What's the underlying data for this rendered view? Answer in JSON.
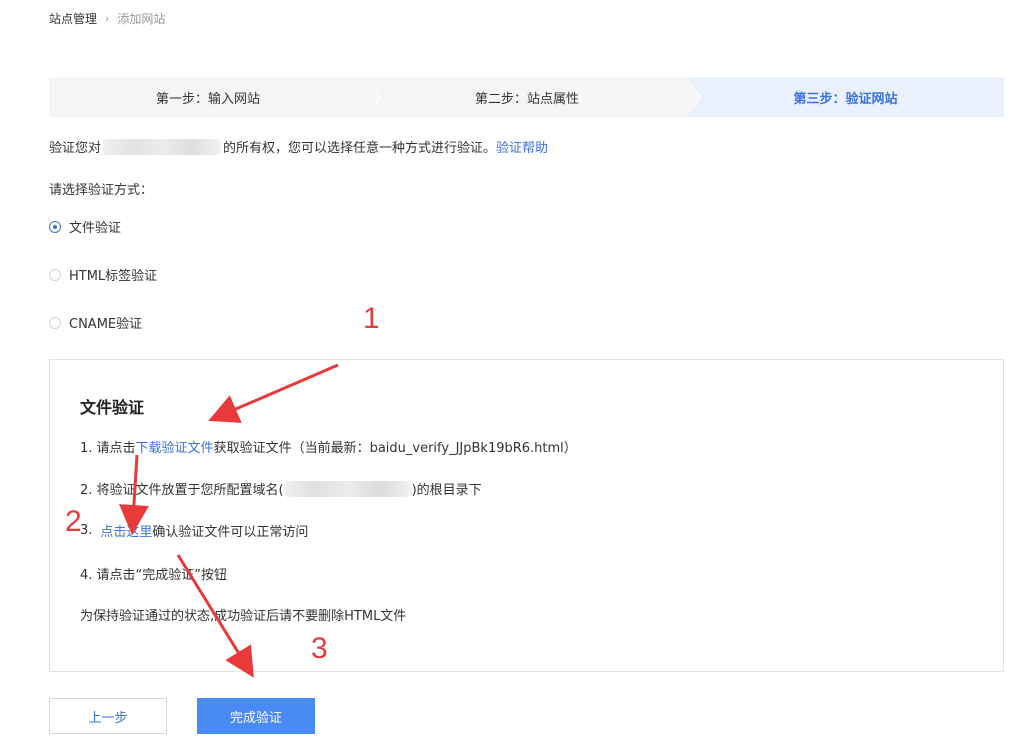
{
  "breadcrumb": {
    "root": "站点管理",
    "separator": "›",
    "current": "添加网站"
  },
  "steps": [
    {
      "label": "第一步：输入网站"
    },
    {
      "label": "第二步：站点属性"
    },
    {
      "label": "第三步：验证网站"
    }
  ],
  "intro": {
    "prefix": "验证您对",
    "suffix": "的所有权，您可以选择任意一种方式进行验证。",
    "help_link": "验证帮助"
  },
  "choose_label": "请选择验证方式：",
  "methods": [
    {
      "label": "文件验证",
      "checked": true
    },
    {
      "label": "HTML标签验证",
      "checked": false
    },
    {
      "label": "CNAME验证",
      "checked": false
    }
  ],
  "panel": {
    "title": "文件验证",
    "step1_prefix": "1.  请点击",
    "step1_link": "下载验证文件",
    "step1_suffix": "获取验证文件（当前最新：baidu_verify_JJpBk19bR6.html）",
    "step2_prefix": "2.  将验证文件放置于您所配置域名(",
    "step2_suffix": ")的根目录下",
    "step3_prefix": "3.",
    "step3_link": "点击这里",
    "step3_suffix": "确认验证文件可以正常访问",
    "step4": "4.  请点击“完成验证”按钮",
    "note": "为保持验证通过的状态,成功验证后请不要删除HTML文件"
  },
  "buttons": {
    "prev": "上一步",
    "done": "完成验证"
  },
  "annotations": {
    "one": "1",
    "two": "2",
    "three": "3"
  },
  "colors": {
    "accent": "#3b72e0",
    "primary_button": "#4a8af4",
    "annotation": "#e8393b"
  }
}
